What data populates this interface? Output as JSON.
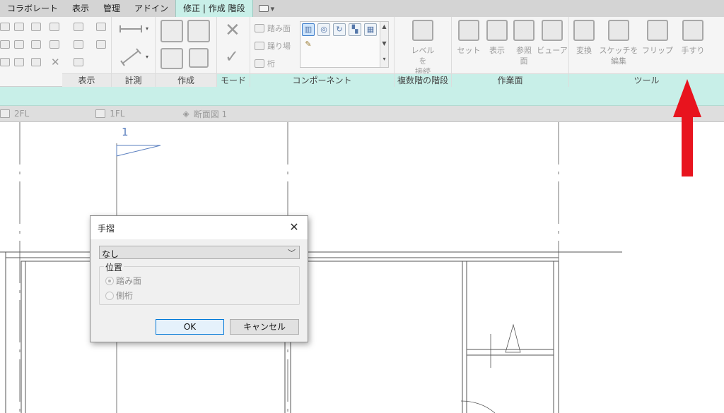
{
  "menubar": {
    "items": [
      "コラボレート",
      "表示",
      "管理",
      "アドイン",
      "修正 | 作成 階段"
    ],
    "active_index": 4
  },
  "ribbon": {
    "panels": {
      "display": "表示",
      "measure": "計測",
      "create": "作成",
      "mode": "モード",
      "component": "コンポーネント",
      "multistory": "複数階の階段",
      "workplane": "作業面",
      "tools": "ツール"
    },
    "component_items": {
      "tread": "踏み面",
      "landing": "踊り場",
      "stringer": "桁"
    },
    "multistory_button": {
      "line1": "レベルを",
      "line2": "接続"
    },
    "workplane_buttons": {
      "set": "セット",
      "show": "表示",
      "ref_line1": "参照",
      "ref_line2": "面",
      "viewer": "ビューア"
    },
    "tools_buttons": {
      "convert": "変換",
      "edit_sketch_line1": "スケッチを",
      "edit_sketch_line2": "編集",
      "flip": "フリップ",
      "railing": "手すり"
    }
  },
  "view_tabs": [
    {
      "label": "2FL",
      "icon": "floor-plan-icon"
    },
    {
      "label": "1FL",
      "icon": "floor-plan-icon"
    },
    {
      "label": "断面図 1",
      "icon": "section-view-icon"
    }
  ],
  "canvas": {
    "section_marker_label": "1"
  },
  "dialog": {
    "title": "手摺",
    "close_glyph": "✕",
    "type_selected": "なし",
    "dropdown_arrow": "﹀",
    "position_group_label": "位置",
    "options": [
      "踏み面",
      "側桁"
    ],
    "selected_option": 0,
    "ok_label": "OK",
    "cancel_label": "キャンセル"
  },
  "colors": {
    "accent_teal": "#c8efe8",
    "annotation_red": "#e8141e",
    "ok_border": "#0078d7"
  }
}
